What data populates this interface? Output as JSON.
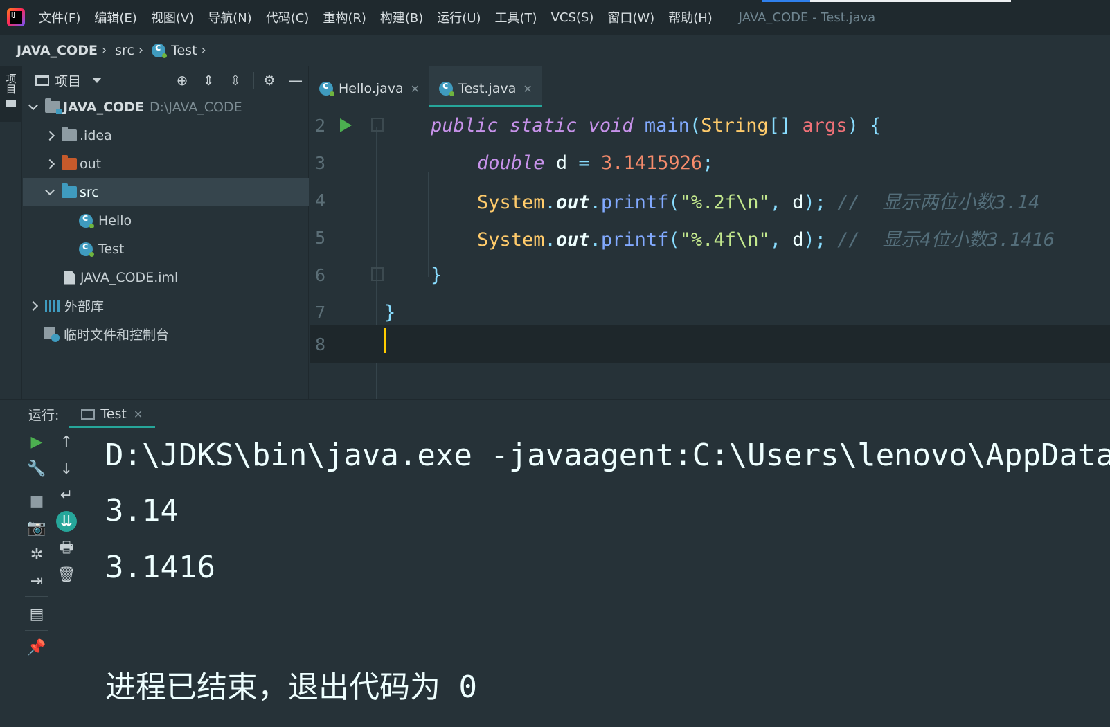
{
  "menubar": {
    "logo_text": "IJ",
    "items": [
      "文件(F)",
      "编辑(E)",
      "视图(V)",
      "导航(N)",
      "代码(C)",
      "重构(R)",
      "构建(B)",
      "运行(U)",
      "工具(T)",
      "VCS(S)",
      "窗口(W)",
      "帮助(H)"
    ],
    "window_title": "JAVA_CODE - Test.java"
  },
  "breadcrumb": {
    "project": "JAVA_CODE",
    "folder": "src",
    "file": "Test"
  },
  "left_strip": {
    "project_tab_label": "项目"
  },
  "project_panel": {
    "title": "项目",
    "toolbar_icons": [
      "locate-icon",
      "expand-all-icon",
      "collapse-all-icon",
      "gear-icon",
      "hide-icon"
    ],
    "tree": {
      "root_name": "JAVA_CODE",
      "root_path": "D:\\JAVA_CODE",
      "idea": ".idea",
      "out": "out",
      "src": "src",
      "hello": "Hello",
      "test": "Test",
      "iml": "JAVA_CODE.iml",
      "external_libs": "外部库",
      "scratches": "临时文件和控制台"
    }
  },
  "editor": {
    "tabs": [
      {
        "label": "Hello.java",
        "active": false
      },
      {
        "label": "Test.java",
        "active": true
      }
    ],
    "lines": {
      "l2": {
        "num": "2",
        "kw1": "public",
        "kw2": "static",
        "kw3": "void",
        "fn": "main",
        "p1": "(",
        "typ": "String",
        "br": "[]",
        "prm": "args",
        "p2": ")",
        "brace": "{"
      },
      "l3": {
        "num": "3",
        "kw": "double",
        "var": "d",
        "op": "=",
        "num_val": "3.1415926",
        "semi": ";"
      },
      "l4": {
        "num": "4",
        "cls": "System",
        "dot1": ".",
        "fld": "out",
        "dot2": ".",
        "fn": "printf",
        "p1": "(",
        "str": "\"%.2f\\n\"",
        "comma": ",",
        "var": "d",
        "p2": ");",
        "cmt_slash": "//",
        "cmt": "显示两位小数3.14"
      },
      "l5": {
        "num": "5",
        "cls": "System",
        "dot1": ".",
        "fld": "out",
        "dot2": ".",
        "fn": "printf",
        "p1": "(",
        "str": "\"%.4f\\n\"",
        "comma": ",",
        "var": "d",
        "p2": ");",
        "cmt_slash": "//",
        "cmt": "显示4位小数3.1416"
      },
      "l6": {
        "num": "6",
        "brace": "}"
      },
      "l7": {
        "num": "7",
        "brace": "}"
      },
      "l8": {
        "num": "8"
      }
    },
    "colors": {
      "keyword": "#c792ea",
      "function": "#82aaff",
      "string": "#c3e88d",
      "number": "#f78c6c",
      "comment": "#546e7a",
      "type": "#ffcb6b"
    }
  },
  "run_panel": {
    "label": "运行:",
    "tab": "Test",
    "left_icons": [
      "run-icon",
      "wrench-icon",
      "stop-icon",
      "camera-icon",
      "debug-settings-icon",
      "login-icon",
      "layout-icon",
      "pin-icon"
    ],
    "right_icons": [
      "up-arrow-icon",
      "down-arrow-icon",
      "soft-wrap-icon",
      "scroll-to-end-icon",
      "print-icon",
      "trash-icon"
    ],
    "console": {
      "cmd": "D:\\JDKS\\bin\\java.exe -javaagent:C:\\Users\\lenovo\\AppData\\",
      "out1": "3.14",
      "out2": "3.1416",
      "exit": "进程已结束，退出代码为 0"
    }
  },
  "accent_color": "#26a69a"
}
